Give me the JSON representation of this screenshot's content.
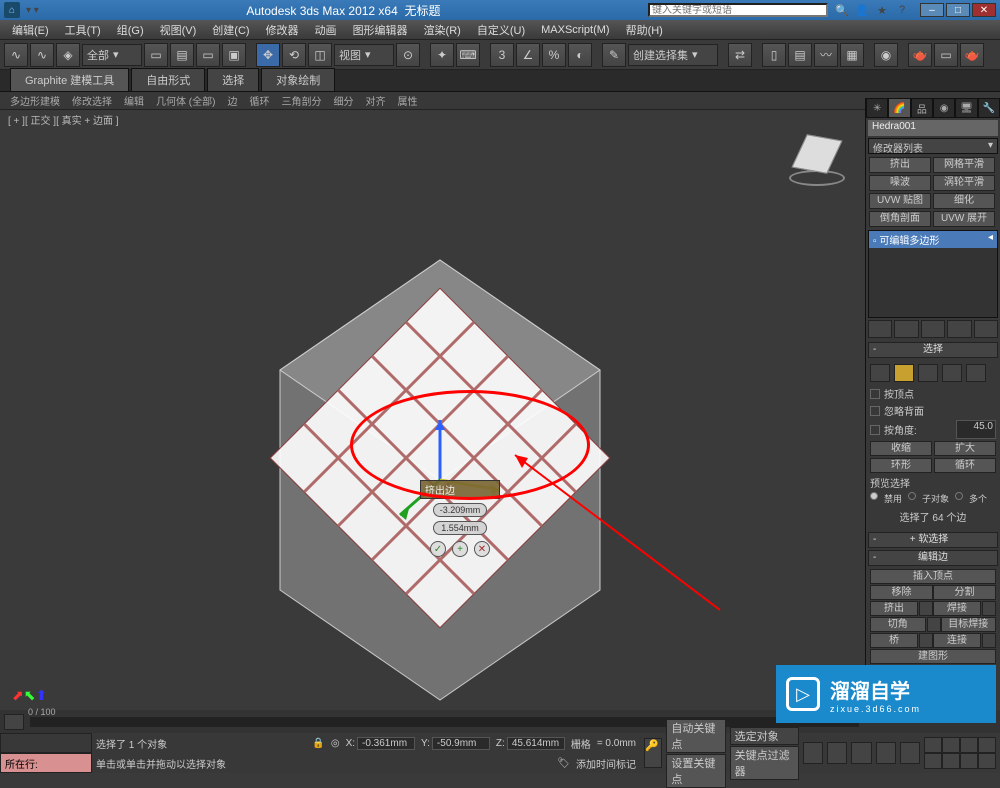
{
  "title": {
    "app": "Autodesk 3ds Max 2012 x64",
    "doc": "无标题",
    "search_placeholder": "键入关键字或短语"
  },
  "menus": [
    "编辑(E)",
    "工具(T)",
    "组(G)",
    "视图(V)",
    "创建(C)",
    "修改器",
    "动画",
    "图形编辑器",
    "渲染(R)",
    "自定义(U)",
    "MAXScript(M)",
    "帮助(H)"
  ],
  "toolbar": {
    "scope": "全部",
    "view": "视图",
    "selset": "创建选择集"
  },
  "ribbon": {
    "tabs": [
      "Graphite 建模工具",
      "自由形式",
      "选择",
      "对象绘制"
    ],
    "sub": [
      "多边形建模",
      "修改选择",
      "编辑",
      "几何体 (全部)",
      "边",
      "循环",
      "三角剖分",
      "细分",
      "对齐",
      "属性"
    ]
  },
  "viewport": {
    "label": "[ + ][ 正交 ][ 真实 + 边面 ]"
  },
  "caddy": {
    "title": "挤出边",
    "field1": "-3.209mm",
    "field2": "1.554mm"
  },
  "cmd": {
    "objname": "Hedra001",
    "modlist": "修改器列表",
    "btns": [
      "挤出",
      "网格平滑",
      "噪波",
      "涡轮平滑",
      "UVW 贴图",
      "细化",
      "倒角剖面",
      "UVW 展开"
    ],
    "stack_item": "可编辑多边形",
    "rollouts": {
      "selection": "选择",
      "by_vertex": "按顶点",
      "ignore_backface": "忽略背面",
      "by_angle": "按角度:",
      "angle_val": "45.0",
      "shrink": "收缩",
      "grow": "扩大",
      "ring": "环形",
      "loop": "循环",
      "preview_lbl": "预览选择",
      "preview_opts": [
        "禁用",
        "子对象",
        "多个"
      ],
      "sel_info": "选择了 64 个边",
      "soft_sel": "软选择",
      "edit_edges": "编辑边",
      "insert_vertex": "插入顶点",
      "remove": "移除",
      "split": "分割",
      "extrude": "挤出",
      "weld": "焊接",
      "chamfer": "切角",
      "target_weld": "目标焊接",
      "bridge": "桥",
      "connect": "连接",
      "create_shape": "建图形"
    }
  },
  "timeline": {
    "range": "0 / 100"
  },
  "status": {
    "prompt1": "选择了 1 个对象",
    "prompt2": "单击或单击并拖动以选择对象",
    "loc_label": "所在行:",
    "x": "-0.361mm",
    "y": "-50.9mm",
    "z": "45.614mm",
    "grid_lbl": "栅格",
    "grid_val": "= 0.0mm",
    "add_tag": "添加时间标记",
    "autokey": "自动关键点",
    "selkey": "选定对象",
    "setkey": "设置关键点",
    "keyfilter": "关键点过滤器"
  },
  "watermark": {
    "brand": "溜溜自学",
    "url": "zixue.3d66.com"
  }
}
